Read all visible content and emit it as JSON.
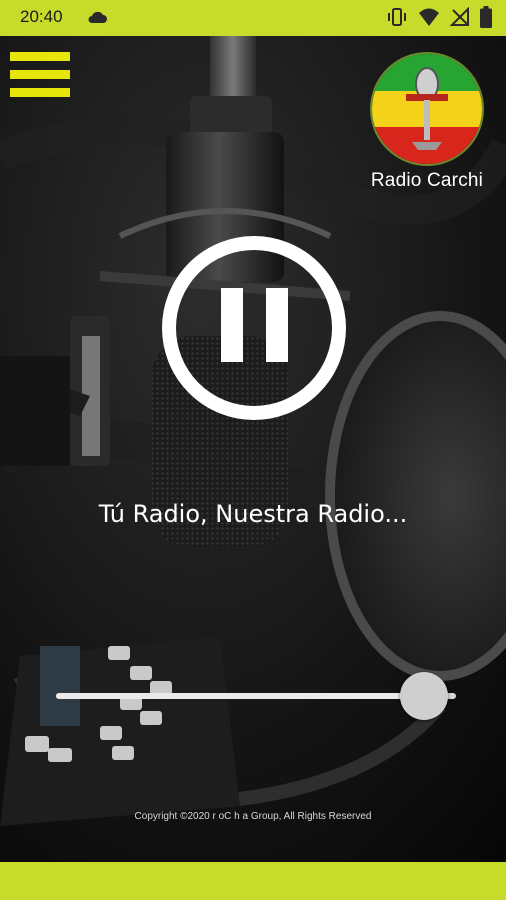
{
  "status_bar": {
    "time": "20:40",
    "icons": [
      "cloud-icon",
      "vibrate-icon",
      "wifi-icon",
      "no-signal-icon",
      "battery-icon"
    ],
    "color": "#c7dc2a"
  },
  "app": {
    "menu_icon": "hamburger-menu-icon",
    "logo_text": "Radio Carchi",
    "playback_state": "playing",
    "control_icon": "pause-icon",
    "tagline": "Tú Radio, Nuestra Radio...",
    "volume_fraction": 0.92,
    "copyright": "Copyright ©2020 r oC h a Group, All Rights Reserved"
  },
  "colors": {
    "accent": "#c7dc2a",
    "menu": "#e6e60a",
    "control": "#ffffff"
  }
}
